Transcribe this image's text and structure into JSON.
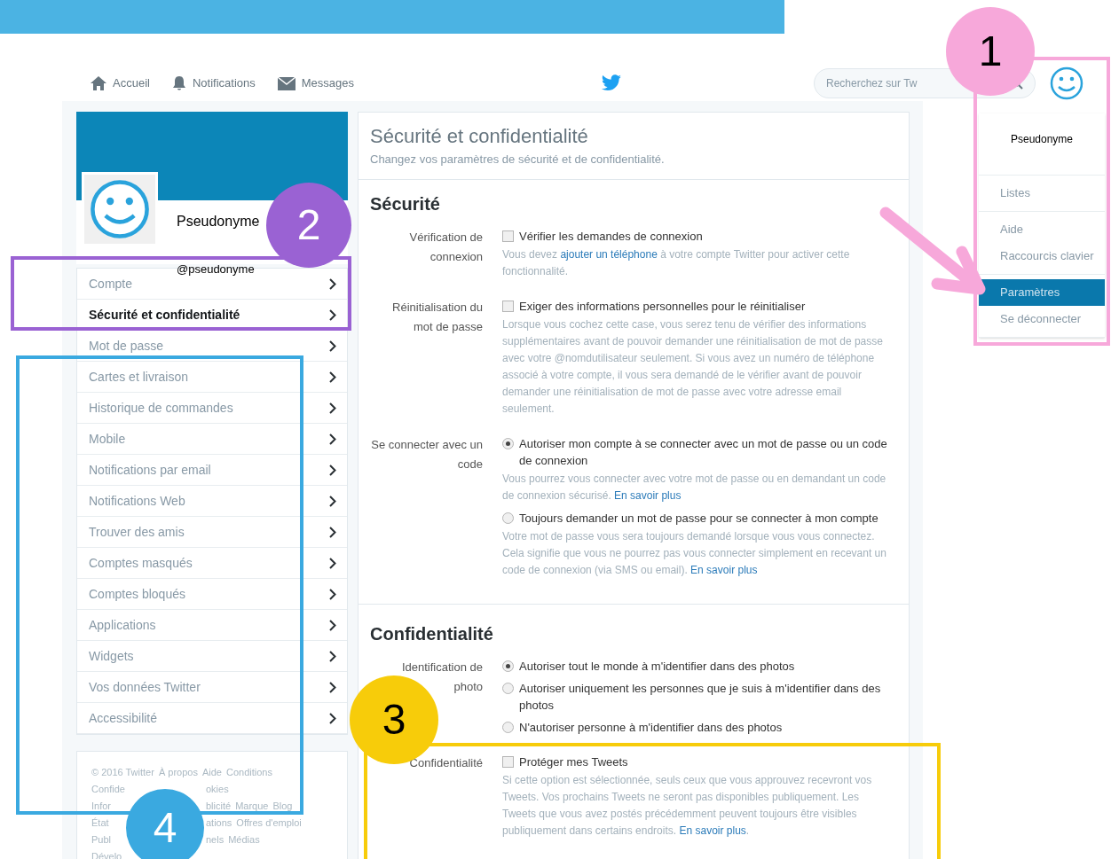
{
  "nav": {
    "items": [
      {
        "kind": "home",
        "label": "Accueil"
      },
      {
        "kind": "bell",
        "label": "Notifications"
      },
      {
        "kind": "mail",
        "label": "Messages"
      }
    ],
    "search": {
      "placeholder": "Recherchez sur Tw"
    }
  },
  "menu": {
    "name": "Pseudonyme",
    "groups": [
      [
        {
          "label": "Listes",
          "selected": false
        }
      ],
      [
        {
          "label": "Aide",
          "selected": false
        },
        {
          "label": "Raccourcis clavier",
          "selected": false
        }
      ],
      [
        {
          "label": "Paramètres",
          "selected": true
        },
        {
          "label": "Se déconnecter",
          "selected": false
        }
      ]
    ]
  },
  "profile": {
    "name": "Pseudonyme",
    "handle": "@pseudonyme"
  },
  "sidebar": {
    "items": [
      {
        "label": "Compte",
        "selected": false
      },
      {
        "label": "Sécurité et confidentialité",
        "selected": true
      },
      {
        "label": "Mot de passe",
        "selected": false
      },
      {
        "label": "Cartes et livraison",
        "selected": false
      },
      {
        "label": "Historique de commandes",
        "selected": false
      },
      {
        "label": "Mobile",
        "selected": false
      },
      {
        "label": "Notifications par email",
        "selected": false
      },
      {
        "label": "Notifications Web",
        "selected": false
      },
      {
        "label": "Trouver des amis",
        "selected": false
      },
      {
        "label": "Comptes masqués",
        "selected": false
      },
      {
        "label": "Comptes bloqués",
        "selected": false
      },
      {
        "label": "Applications",
        "selected": false
      },
      {
        "label": "Widgets",
        "selected": false
      },
      {
        "label": "Vos données Twitter",
        "selected": false
      },
      {
        "label": "Accessibilité",
        "selected": false
      }
    ]
  },
  "footer": {
    "lines": [
      {
        "before": [
          "© 2016 Twitter",
          "À propos",
          "Aide",
          "Conditions"
        ]
      },
      {
        "before": [
          "Confide"
        ],
        "after": [
          "okies"
        ]
      },
      {
        "before": [
          "Infor"
        ],
        "after": [
          "blicité",
          "Marque",
          "Blog"
        ]
      },
      {
        "before": [
          "État"
        ],
        "after": [
          "ations",
          "Offres d'emploi"
        ]
      },
      {
        "before": [
          "Publ"
        ],
        "after": [
          "nels",
          "Médias"
        ]
      },
      {
        "before": [
          "Dévelo"
        ]
      }
    ]
  },
  "main": {
    "title": "Sécurité et confidentialité",
    "subtitle": "Changez vos paramètres de sécurité et de confidentialité.",
    "sections": [
      {
        "heading": "Sécurité",
        "settings": [
          {
            "label": "Vérification de connexion",
            "options": [
              {
                "kind": "checkbox",
                "label": "Vérifier les demandes de connexion",
                "checked": false,
                "help": {
                  "before": "Vous devez ",
                  "link": "ajouter un téléphone",
                  "after": " à votre compte Twitter pour activer cette fonctionnalité."
                }
              }
            ]
          },
          {
            "label": "Réinitialisation du mot de passe",
            "options": [
              {
                "kind": "checkbox",
                "label": "Exiger des informations personnelles pour le réinitialiser",
                "checked": false,
                "help": {
                  "before": "Lorsque vous cochez cette case, vous serez tenu de vérifier des informations supplémentaires avant de pouvoir demander une réinitialisation de mot de passe avec votre @nomdutilisateur seulement. Si vous avez un numéro de téléphone associé à votre compte, il vous sera demandé de le vérifier avant de pouvoir demander une réinitialisation de mot de passe avec votre adresse email seulement."
                }
              }
            ]
          },
          {
            "label": "Se connecter avec un code",
            "options": [
              {
                "kind": "radio",
                "label": "Autoriser mon compte à se connecter avec un mot de passe ou un code de connexion",
                "checked": true,
                "help": {
                  "before": "Vous pourrez vous connecter avec votre mot de passe ou en demandant un code de connexion sécurisé. ",
                  "link": "En savoir plus"
                }
              },
              {
                "kind": "radio",
                "label": "Toujours demander un mot de passe pour se connecter à mon compte",
                "checked": false,
                "help": {
                  "before": "Votre mot de passe vous sera toujours demandé lorsque vous vous connectez. Cela signifie que vous ne pourrez pas vous connecter simplement en recevant un code de connexion (via SMS ou email). ",
                  "link": "En savoir plus"
                }
              }
            ]
          }
        ]
      },
      {
        "heading": "Confidentialité",
        "settings": [
          {
            "label": "Identification de photo",
            "options": [
              {
                "kind": "radio",
                "label": "Autoriser tout le monde à m'identifier dans des photos",
                "checked": true
              },
              {
                "kind": "radio",
                "label": "Autoriser uniquement les personnes que je suis à m'identifier dans des photos",
                "checked": false
              },
              {
                "kind": "radio",
                "label": "N'autoriser personne à m'identifier dans des photos",
                "checked": false
              }
            ]
          },
          {
            "label": "Confidentialité",
            "options": [
              {
                "kind": "checkbox",
                "label": "Protéger mes Tweets",
                "checked": false,
                "help": {
                  "before": "Si cette option est sélectionnée, seuls ceux que vous approuvez recevront vos Tweets. Vos prochains Tweets ne seront pas disponibles publiquement. Les Tweets que vous avez postés précédemment peuvent toujours être visibles publiquement dans certains endroits. ",
                  "link": "En savoir plus",
                  "after": "."
                }
              }
            ]
          }
        ]
      }
    ]
  },
  "callouts": [
    {
      "label": "1",
      "color": "#f7a8da",
      "light_label": false
    },
    {
      "label": "2",
      "color": "#9a62d3",
      "light_label": true
    },
    {
      "label": "3",
      "color": "#f7cc0a",
      "light_label": false
    },
    {
      "label": "4",
      "color": "#3aa9e0",
      "light_label": true
    }
  ]
}
